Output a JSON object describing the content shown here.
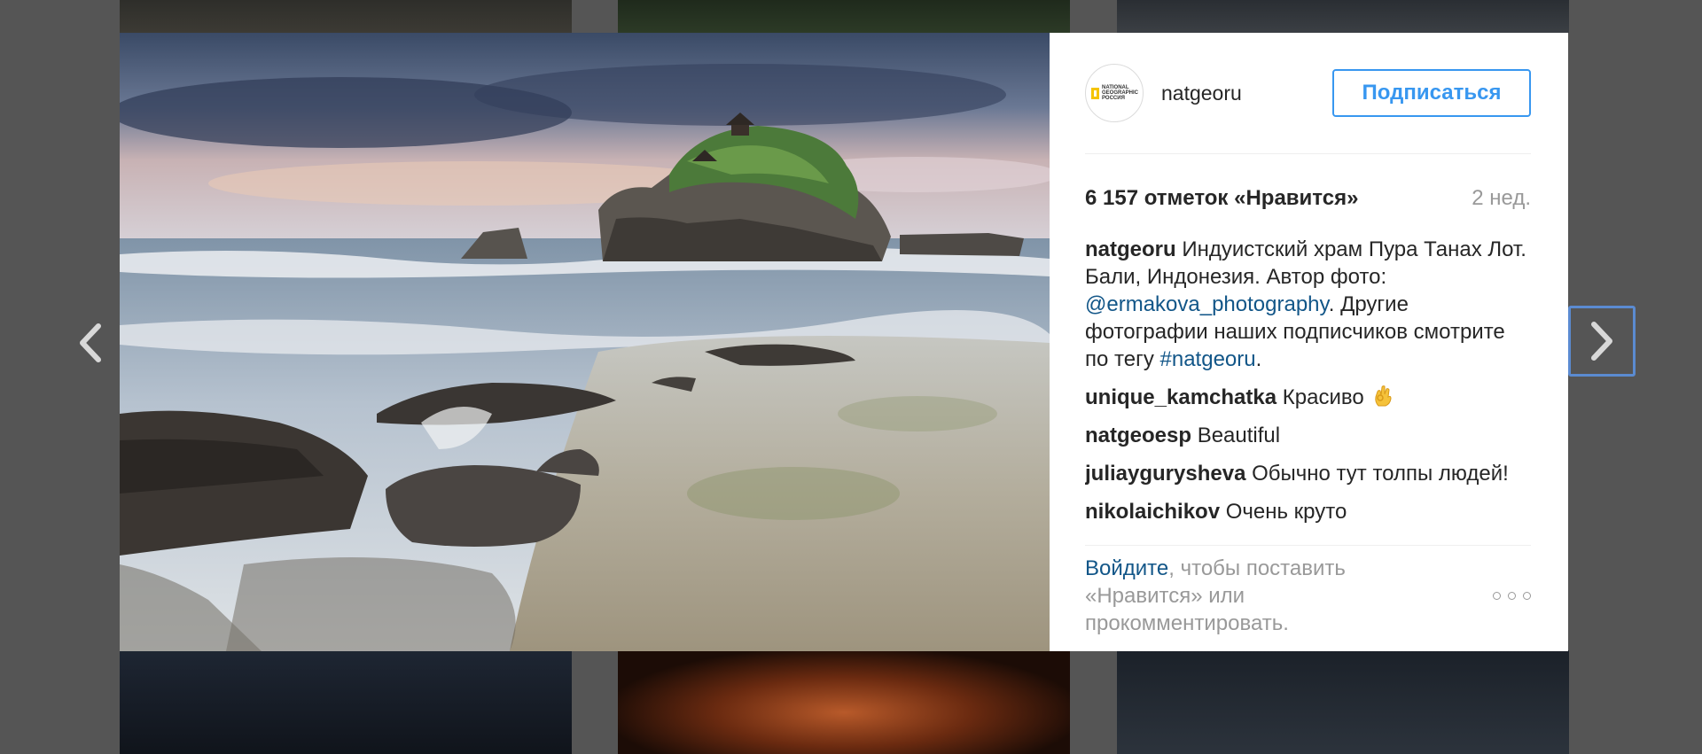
{
  "post": {
    "username": "natgeoru",
    "follow_label": "Подписаться",
    "avatar_logo": "NATIONAL GEOGRAPHIC РОССИЯ",
    "likes": "6 157 отметок «Нравится»",
    "time_ago": "2 нед.",
    "caption": {
      "author": "natgeoru",
      "text_1": " Индуистский храм Пура Танах Лот. Бали, Индонезия. Автор фото: ",
      "mention": "@ermakova_photography",
      "text_2": ". Другие фотографии наших подписчиков смотрите по тегу ",
      "hashtag": "#natgeoru",
      "text_3": "."
    },
    "comments": [
      {
        "author": "unique_kamchatka",
        "text": " Красиво"
      },
      {
        "author": "natgeoesp",
        "text": " Beautiful"
      },
      {
        "author": "juliaygurysheva",
        "text": " Обычно тут толпы людей!"
      },
      {
        "author": "nikolaichikov",
        "text": " Очень круто"
      }
    ],
    "login_link": "Войдите",
    "login_rest": ", чтобы поставить «Нравится» или прокомментировать."
  },
  "icons": {
    "prev": "chevron-left-icon",
    "next": "chevron-right-icon",
    "more": "more-dots-icon",
    "emoji": "ok-hand-emoji-icon"
  },
  "colors": {
    "accent": "#3897f0",
    "link": "#125688",
    "backdrop": "#4a4a4a"
  }
}
